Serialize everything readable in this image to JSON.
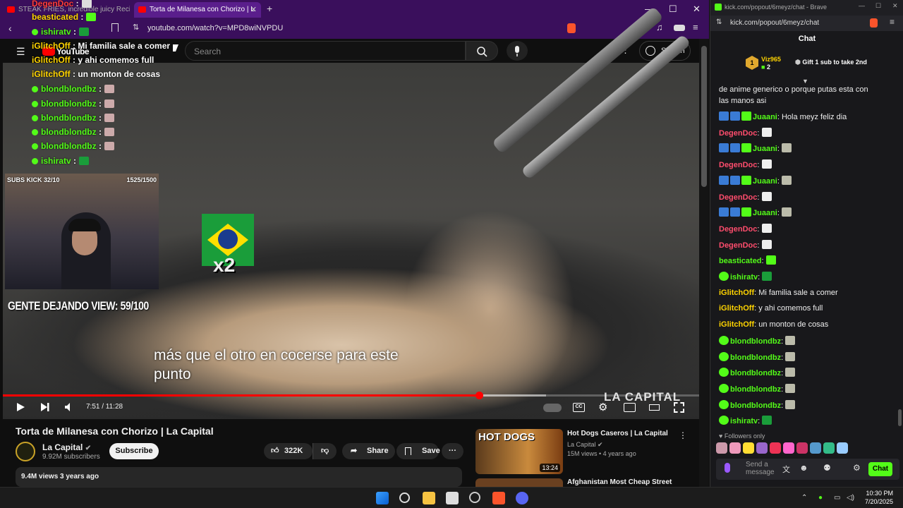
{
  "browser_left": {
    "tabs": [
      {
        "label": "STEAK FRIES, incredible juicy Recipe"
      },
      {
        "label": "Torta de Milanesa con Chorizo | L"
      }
    ],
    "url": "youtube.com/watch?v=MPD8wiNVPDU"
  },
  "youtube": {
    "logo": "YouTube",
    "search_placeholder": "Search",
    "sign_in_label": "Sign in",
    "subtitle_line1": "más que el otro en cocerse para este",
    "subtitle_line2": "punto",
    "time_display": "7:51 / 11:28",
    "progress_fraction": 0.684,
    "buffered_fraction": 0.78,
    "watermark": "LA CAPITAL",
    "video_title": "Torta de Milanesa con Chorizo | La Capital",
    "channel_name": "La Capital",
    "channel_subs": "9.92M subscribers",
    "subscribe_label": "Subscribe",
    "likes": "322K",
    "share_label": "Share",
    "save_label": "Save",
    "description_meta": "9.4M views  3 years ago",
    "recommended": [
      {
        "thumb_text": "HOT  DOGS",
        "duration": "13:24",
        "title": "Hot Dogs Caseros | La Capital",
        "channel": "La Capital",
        "meta": "15M views • 4 years ago"
      },
      {
        "title": "Afghanistan Most Cheap Street"
      }
    ]
  },
  "stream_overlay": {
    "chat_lines": [
      {
        "user": "DegenDoc",
        "sep": " :",
        "text": "",
        "color": "red"
      },
      {
        "user": "beasticated",
        "sep": " :",
        "text": "",
        "color": "yellow"
      },
      {
        "user": "ishiratv",
        "sep": " :",
        "text": "",
        "color": "green"
      },
      {
        "user": "iGlitchOff",
        "sep": " : ",
        "text": "Mi familia sale a comer",
        "color": "yellow"
      },
      {
        "user": "iGlitchOff",
        "sep": " : ",
        "text": "y ahi comemos full",
        "color": "yellow"
      },
      {
        "user": "iGlitchOff",
        "sep": " : ",
        "text": "un monton de cosas",
        "color": "yellow"
      },
      {
        "user": "blondblondbz",
        "sep": " :",
        "text": "",
        "color": "green"
      },
      {
        "user": "blondblondbz",
        "sep": " :",
        "text": "",
        "color": "green"
      },
      {
        "user": "blondblondbz",
        "sep": " :",
        "text": "",
        "color": "green"
      },
      {
        "user": "blondblondbz",
        "sep": " :",
        "text": "",
        "color": "green"
      },
      {
        "user": "blondblondbz",
        "sep": " :",
        "text": "",
        "color": "green"
      },
      {
        "user": "ishiratv",
        "sep": " :",
        "text": "",
        "color": "green"
      }
    ],
    "cam_subs": "SUBS KICK 32/10",
    "cam_count": "1525/1500",
    "view_goal": "GENTE DEJANDO VIEW: 59/100",
    "flag_multiplier": "x2"
  },
  "kick_chat": {
    "window_url_title": "kick.com/popout/6meyz/chat - Brave",
    "url": "kick.com/popout/6meyz/chat",
    "header": "Chat",
    "gift_leader": {
      "rank": "1",
      "user": "Viz965",
      "count": "2",
      "cta": "Gift 1 sub to take 2nd"
    },
    "messages": [
      {
        "user": "",
        "text": "de anime generico o porque putas esta con"
      },
      {
        "user": "",
        "text": "las manos asi"
      },
      {
        "user": "Juaani",
        "text": "Hola meyz feliz dia",
        "color": "green",
        "badges": [
          "blue",
          "blue",
          "green"
        ]
      },
      {
        "user": "DegenDoc",
        "text": "",
        "color": "red",
        "badges": [],
        "emote": "lg"
      },
      {
        "user": "Juaani",
        "text": "",
        "color": "green",
        "badges": [
          "blue",
          "blue",
          "green"
        ]
      },
      {
        "user": "DegenDoc",
        "text": "",
        "color": "red",
        "badges": [],
        "emote": "lg"
      },
      {
        "user": "Juaani",
        "text": "",
        "color": "green",
        "badges": [
          "blue",
          "blue",
          "green"
        ]
      },
      {
        "user": "DegenDoc",
        "text": "",
        "color": "red",
        "badges": [],
        "emote": "lg"
      },
      {
        "user": "Juaani",
        "text": "",
        "color": "green",
        "badges": [
          "blue",
          "blue",
          "green"
        ]
      },
      {
        "user": "DegenDoc",
        "text": "",
        "color": "red",
        "badges": [],
        "emote": "lg"
      },
      {
        "user": "DegenDoc",
        "text": "",
        "color": "red",
        "badges": [],
        "emote": "lg"
      },
      {
        "user": "beasticated",
        "text": "",
        "color": "green",
        "badges": []
      },
      {
        "user": "ishiratv",
        "text": "",
        "color": "green",
        "badges": [
          "vbadge"
        ],
        "emote": "brz"
      },
      {
        "user": "iGlitchOff",
        "text": "Mi familia sale a comer",
        "color": "yellow",
        "badges": []
      },
      {
        "user": "iGlitchOff",
        "text": "y ahi comemos full",
        "color": "yellow",
        "badges": []
      },
      {
        "user": "iGlitchOff",
        "text": "un monton de cosas",
        "color": "yellow",
        "badges": []
      },
      {
        "user": "blondblondbz",
        "text": "",
        "color": "green",
        "badges": [
          "vbadge"
        ]
      },
      {
        "user": "blondblondbz",
        "text": "",
        "color": "green",
        "badges": [
          "vbadge"
        ]
      },
      {
        "user": "blondblondbz",
        "text": "",
        "color": "green",
        "badges": [
          "vbadge"
        ]
      },
      {
        "user": "blondblondbz",
        "text": "",
        "color": "green",
        "badges": [
          "vbadge"
        ]
      },
      {
        "user": "blondblondbz",
        "text": "",
        "color": "green",
        "badges": [
          "vbadge"
        ]
      },
      {
        "user": "ishiratv",
        "text": "",
        "color": "green",
        "badges": [
          "vbadge"
        ],
        "emote": "brz"
      }
    ],
    "followers_only": "Followers only",
    "send_placeholder_1": "Send a",
    "send_placeholder_2": "message",
    "chat_button": "Chat"
  },
  "taskbar": {
    "time": "10:30 PM",
    "date": "7/20/2025"
  },
  "colors": {
    "brand_red": "#ff0000",
    "kick_green": "#53fc18",
    "browser_purple": "#3a0f5c"
  }
}
